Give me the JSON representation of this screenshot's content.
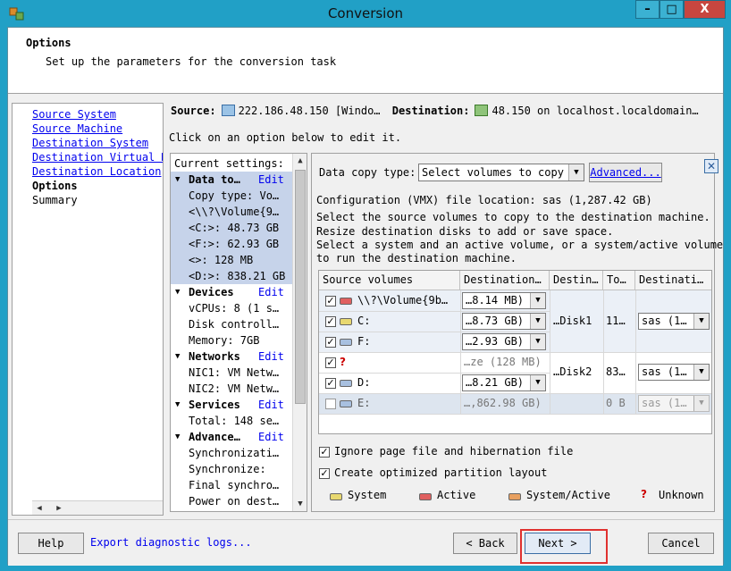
{
  "window": {
    "title": "Conversion",
    "minimize": "–",
    "maximize": "□",
    "close": "X"
  },
  "header": {
    "title": "Options",
    "subtitle": "Set up the parameters for the conversion task"
  },
  "nav": {
    "items": [
      {
        "label": "Source System",
        "link": true
      },
      {
        "label": "Source Machine",
        "link": true
      },
      {
        "label": "Destination System",
        "link": true
      },
      {
        "label": "Destination Virtual M",
        "link": true
      },
      {
        "label": "Destination Location",
        "link": true
      },
      {
        "label": "Options",
        "link": false,
        "current": true
      },
      {
        "label": "Summary",
        "link": false
      }
    ]
  },
  "info": {
    "source_label": "Source:",
    "source_value": "222.186.48.150 [Windo…",
    "destination_label": "Destination:",
    "destination_value": "48.150 on localhost.localdomain…",
    "instruction": "Click on an option below to edit it."
  },
  "settings": {
    "header": "Current settings:",
    "edit_label": "Edit",
    "sections": [
      {
        "title": "Data to…",
        "items": [
          "Copy type: Vo…",
          "<\\\\?\\Volume{9…",
          "<C:>: 48.73 GB",
          "<F:>: 62.93 GB",
          "<>: 128 MB",
          "<D:>: 838.21 GB"
        ]
      },
      {
        "title": "Devices",
        "items": [
          "vCPUs: 8 (1 s…",
          "Disk controll…",
          "Memory: 7GB"
        ]
      },
      {
        "title": "Networks",
        "items": [
          "NIC1: VM Netw…",
          "NIC2: VM Netw…"
        ]
      },
      {
        "title": "Services",
        "items": [
          "Total: 148 se…"
        ]
      },
      {
        "title": "Advance…",
        "items": [
          "Synchronizati…",
          "Synchronize:",
          "Final synchro…",
          "Power on dest…"
        ]
      }
    ]
  },
  "panel": {
    "data_copy_label": "Data copy type:",
    "data_copy_value": "Select volumes to copy",
    "advanced_button": "Advanced...",
    "config_location": "Configuration (VMX) file location: sas (1,287.42 GB)",
    "desc_lines": [
      "Select the source volumes to copy to the destination machine.",
      "Resize destination disks to add or save space.",
      "Select a system and an active volume, or a system/active volume",
      "to run the destination machine."
    ],
    "columns": [
      "Source volumes",
      "Destination…",
      "Destin…",
      "To…",
      "Destinati…"
    ],
    "rows": [
      {
        "checked": true,
        "icon": "active",
        "name": "\\\\?\\Volume{9b…",
        "size": "…8.14 MB)"
      },
      {
        "checked": true,
        "icon": "system",
        "name": "C:",
        "size": "…8.73 GB)"
      },
      {
        "checked": true,
        "icon": "basic",
        "name": "F:",
        "size": "…2.93 GB)"
      },
      {
        "checked": true,
        "icon": "unknown",
        "name": "",
        "size": "…ze (128 MB)"
      },
      {
        "checked": true,
        "icon": "basic",
        "name": "D:",
        "size": "…8.21 GB)"
      },
      {
        "checked": false,
        "icon": "basic",
        "name": "E:",
        "size": "…,862.98 GB)"
      }
    ],
    "disk1": {
      "name": "…Disk1",
      "total": "11…",
      "dest": "sas (1…"
    },
    "disk2": {
      "name": "…Disk2",
      "total": "83…",
      "dest": "sas (1…"
    },
    "disk3": {
      "total": "0 B",
      "dest": "sas (1…"
    },
    "ignore_page_file": "Ignore page file and hibernation file",
    "optimized_layout": "Create optimized partition layout",
    "legend": [
      "System",
      "Active",
      "System/Active",
      "Unknown"
    ]
  },
  "footer": {
    "help": "Help",
    "export_logs": "Export diagnostic logs...",
    "back": "< Back",
    "next": "Next >",
    "cancel": "Cancel"
  },
  "colors": {
    "system": "#e8d870",
    "active": "#e06060",
    "sysactive": "#e8a060",
    "basic": "#a8c0e0",
    "highlight": "#e0312f"
  }
}
